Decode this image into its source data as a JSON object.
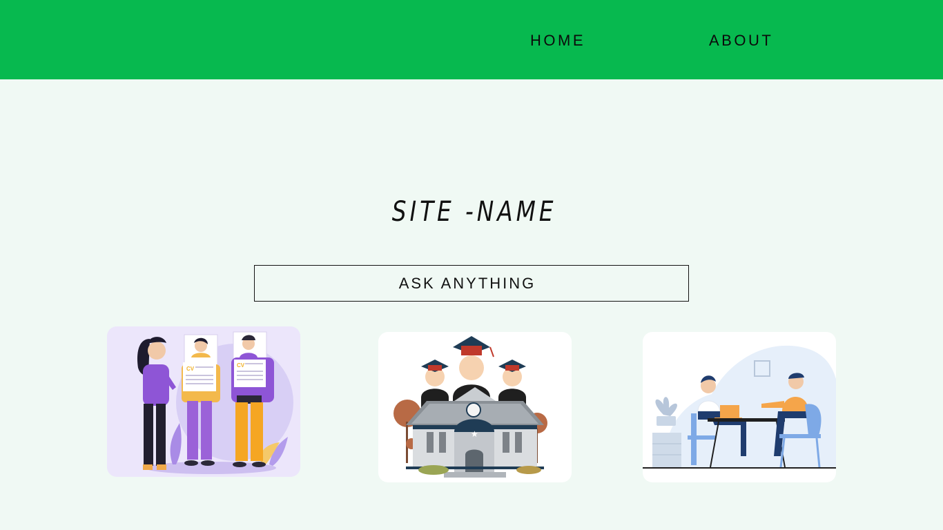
{
  "nav": {
    "home_label": "HOME",
    "about_label": "ABOUT",
    "brand_color": "#07b94f"
  },
  "hero": {
    "title": "SITE -NAME",
    "ask_label": "ASK ANYTHING"
  },
  "cards": [
    {
      "illustration": "cv-recruitment-illustration",
      "cv_label_1": "CV",
      "cv_label_2": "CV"
    },
    {
      "illustration": "graduates-school-illustration"
    },
    {
      "illustration": "interview-meeting-illustration"
    }
  ],
  "colors": {
    "page_background": "#f0f9f4",
    "text": "#111111"
  }
}
